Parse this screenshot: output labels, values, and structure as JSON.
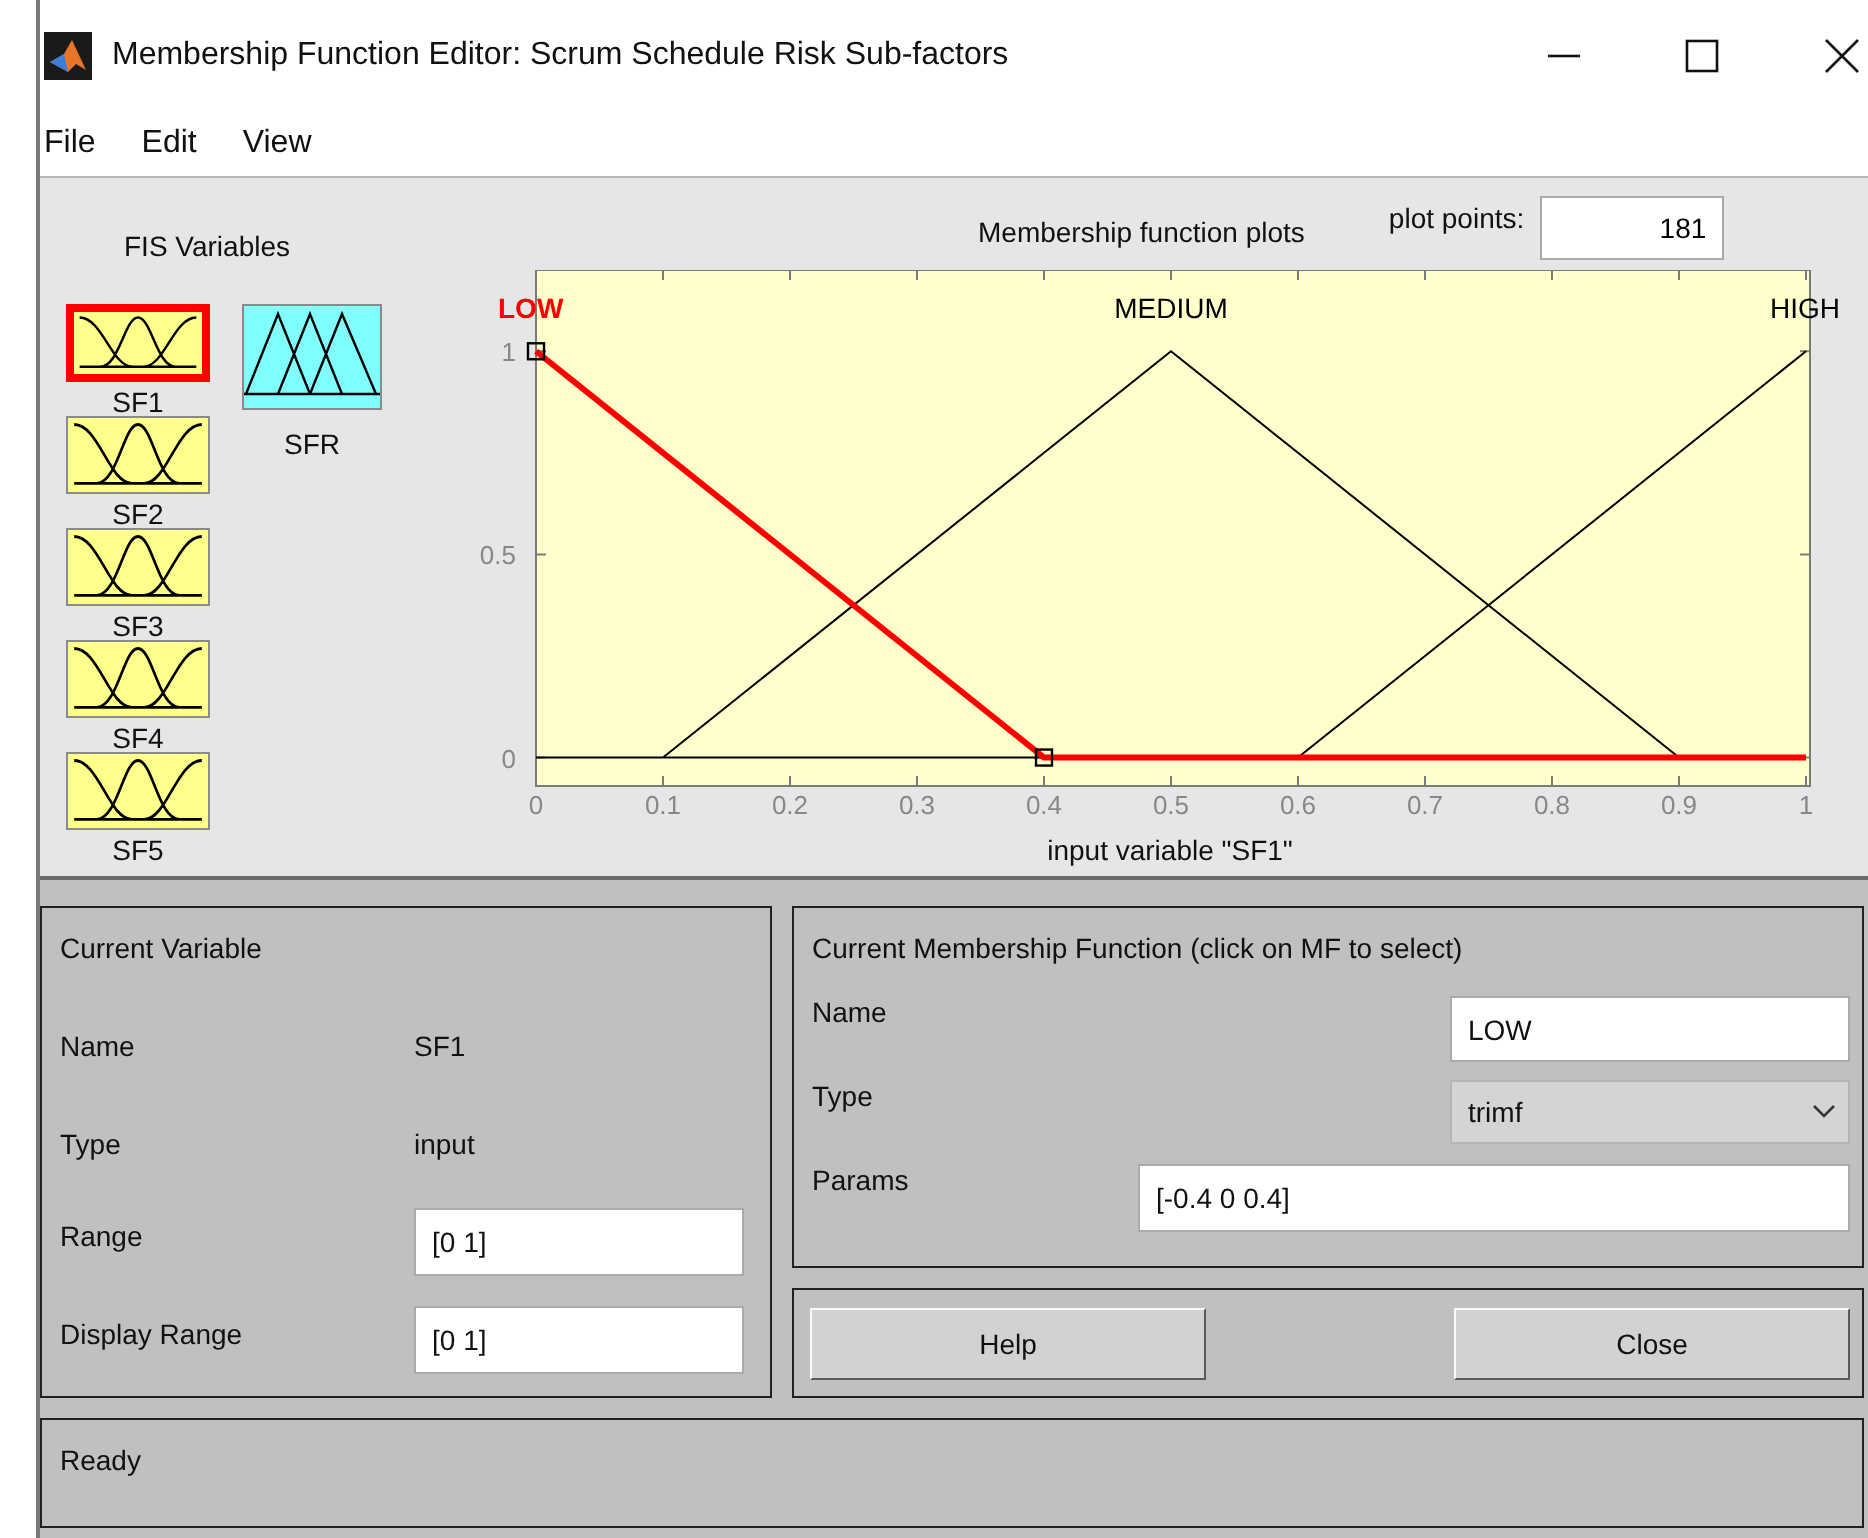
{
  "window": {
    "title": "Membership Function Editor: Scrum Schedule  Risk Sub-factors"
  },
  "menu": [
    "File",
    "Edit",
    "View"
  ],
  "fis_variables": {
    "title": "FIS Variables",
    "inputs": [
      {
        "name": "SF1",
        "selected": true
      },
      {
        "name": "SF2",
        "selected": false
      },
      {
        "name": "SF3",
        "selected": false
      },
      {
        "name": "SF4",
        "selected": false
      },
      {
        "name": "SF5",
        "selected": false
      }
    ],
    "outputs": [
      {
        "name": "SFR",
        "selected": false
      }
    ]
  },
  "plot": {
    "title": "Membership function plots",
    "plot_points_label": "plot points:",
    "plot_points": "181",
    "mf_states": [
      {
        "selected": true
      },
      {
        "selected": false
      },
      {
        "selected": false
      }
    ],
    "chart_data": {
      "type": "line",
      "ylim": [
        -0.07,
        1.2
      ],
      "xlabel": "input variable \"SF1\"",
      "x": [
        0,
        0.1,
        0.4,
        0.5,
        0.6,
        0.9,
        1
      ],
      "xlim": [
        0,
        1
      ],
      "xticks": [
        0,
        0.1,
        0.2,
        0.3,
        0.4,
        0.5,
        0.6,
        0.7,
        0.8,
        0.9,
        1
      ],
      "yticks": [
        0,
        0.5,
        1
      ],
      "series": [
        {
          "name": "LOW",
          "color": "#ff0000",
          "values": [
            1,
            0.75,
            0,
            0,
            0,
            0,
            0
          ]
        },
        {
          "name": "MEDIUM",
          "color": "#000000",
          "values": [
            null,
            0,
            0.75,
            1,
            0.75,
            0,
            null
          ]
        },
        {
          "name": "HIGH",
          "color": "#000000",
          "values": [
            null,
            null,
            null,
            null,
            0,
            0.75,
            1
          ]
        }
      ]
    }
  },
  "current_variable": {
    "title": "Current Variable",
    "fields": [
      {
        "label": "Name",
        "value": "SF1",
        "kind": "text"
      },
      {
        "label": "Type",
        "value": "input",
        "kind": "text"
      },
      {
        "label": "Range",
        "value": "[0 1]",
        "kind": "input"
      },
      {
        "label": "Display Range",
        "value": "[0 1]",
        "kind": "input"
      }
    ]
  },
  "current_mf": {
    "title": "Current Membership Function (click on MF to select)",
    "name_label": "Name",
    "name": "LOW",
    "type_label": "Type",
    "type": "trimf",
    "params_label": "Params",
    "params": "[-0.4 0 0.4]"
  },
  "buttons": [
    "Help",
    "Close"
  ],
  "status": "Ready"
}
